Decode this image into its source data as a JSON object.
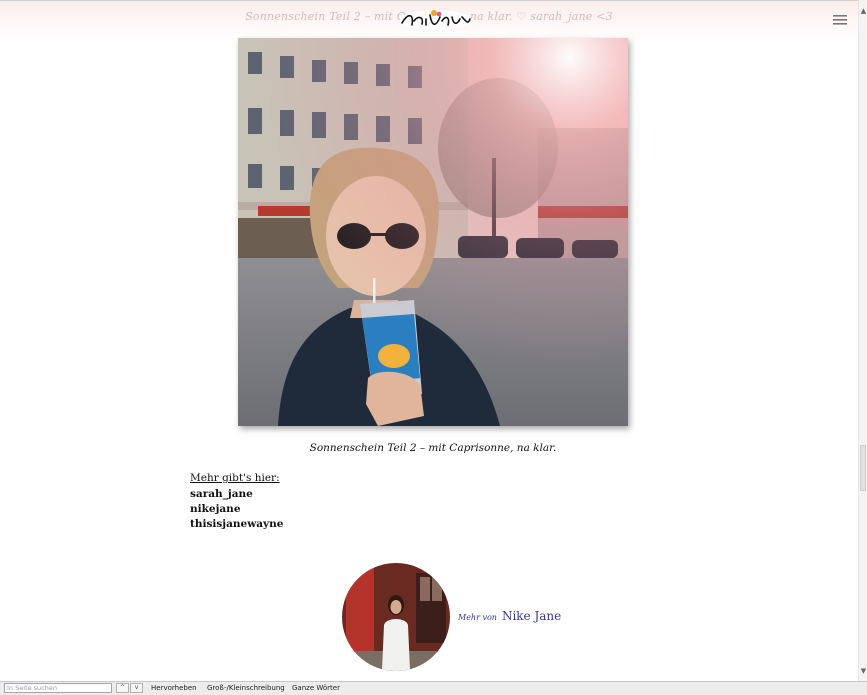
{
  "header": {
    "title": "Sonnenschein Teil 2 – mit Caprisonne, na klar. ♡ sarah_jane <3",
    "menu_icon": "hamburger-menu-icon"
  },
  "post": {
    "caption": "Sonnenschein Teil 2 – mit Caprisonne, na klar.",
    "more_label": "Mehr gibt's hier:",
    "links": [
      "sarah_jane",
      "nikejane",
      "thisisjanewayne"
    ]
  },
  "author": {
    "prefix": "Mehr von",
    "name": "Nike Jane"
  },
  "findbar": {
    "placeholder": "In Seite suchen",
    "prev": "^",
    "next": "v",
    "highlight": "Hervorheben",
    "match_case": "Groß-/Kleinschreibung",
    "whole_words": "Ganze Wörter"
  },
  "scrollbar": {
    "up": "▲",
    "down": "▼"
  },
  "colors": {
    "author_link": "#3a3a8a",
    "header_tint": "#fbeeed"
  }
}
